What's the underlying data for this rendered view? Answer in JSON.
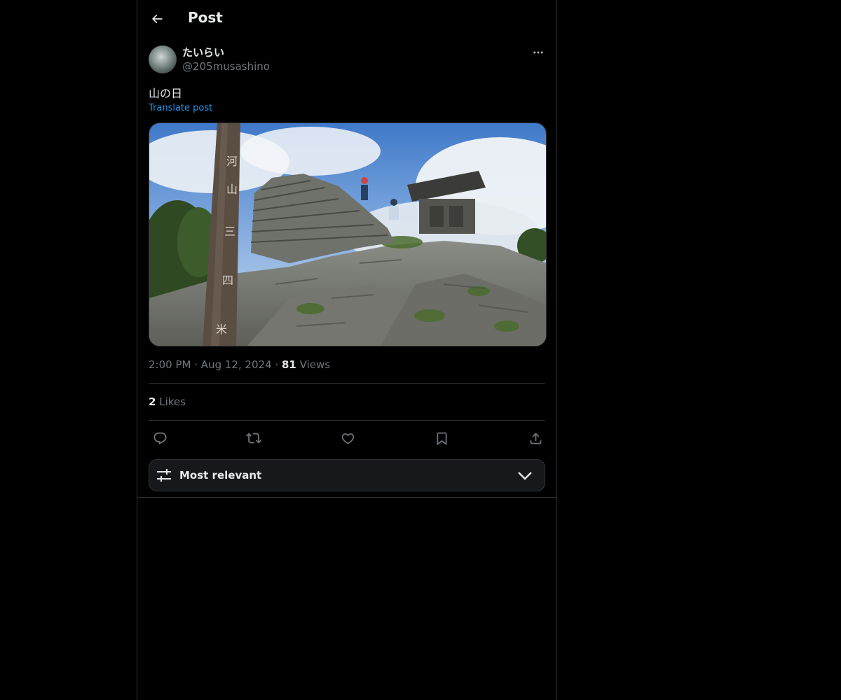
{
  "header": {
    "title": "Post"
  },
  "post": {
    "display_name": "たいらい",
    "handle": "@205musashino",
    "text": "山の日",
    "translate_label": "Translate post",
    "time": "2:00 PM",
    "date": "Aug 12, 2024",
    "views_count": "81",
    "views_label": "Views",
    "likes_count": "2",
    "likes_label": "Likes",
    "separator": "·"
  },
  "sort": {
    "label": "Most relevant"
  },
  "icons": {
    "back": "arrow-left-icon",
    "more": "more-dots-icon",
    "reply": "reply-icon",
    "repost": "repost-icon",
    "like": "heart-icon",
    "bookmark": "bookmark-icon",
    "share": "share-icon",
    "sort": "sliders-icon",
    "chevron": "chevron-down-icon"
  },
  "colors": {
    "link": "#1d9bf0",
    "muted": "#71767b",
    "text": "#e7e9ea",
    "border": "#2f3336"
  }
}
